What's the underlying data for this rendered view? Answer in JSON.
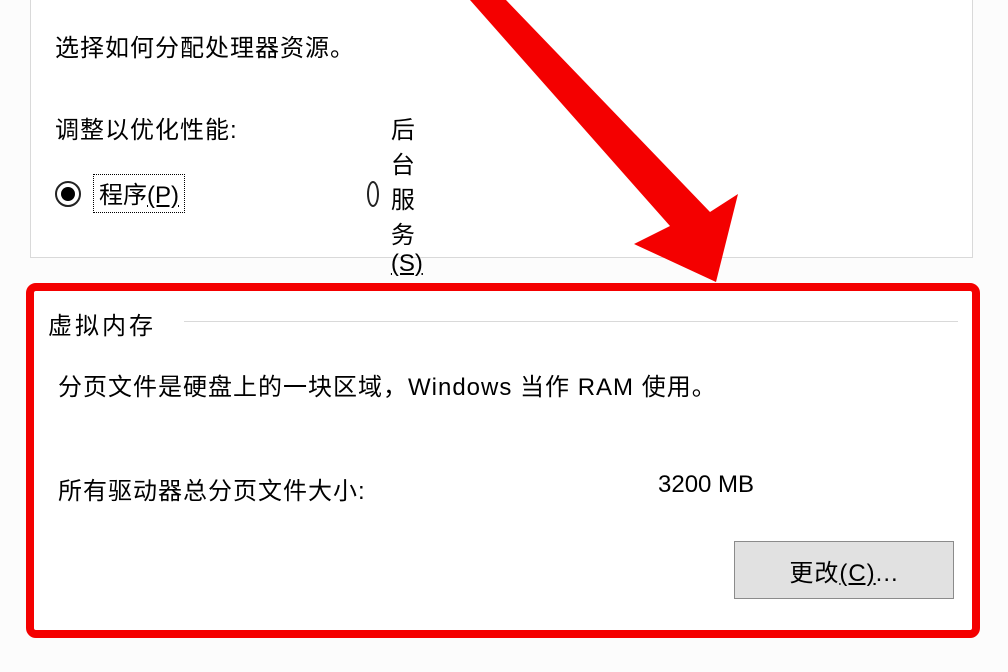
{
  "processor_scheduling": {
    "description": "选择如何分配处理器资源。",
    "adjust_label": "调整以优化性能:",
    "option_programs": "程序",
    "option_programs_accel": "(P)",
    "option_background": "后台服务",
    "option_background_accel": "(S)"
  },
  "virtual_memory": {
    "legend": "虚拟内存",
    "description": "分页文件是硬盘上的一块区域，Windows 当作 RAM 使用。",
    "total_label": "所有驱动器总分页文件大小:",
    "total_value": "3200 MB",
    "change_button_prefix": "更改",
    "change_button_accel": "(C)",
    "change_button_suffix": "..."
  }
}
